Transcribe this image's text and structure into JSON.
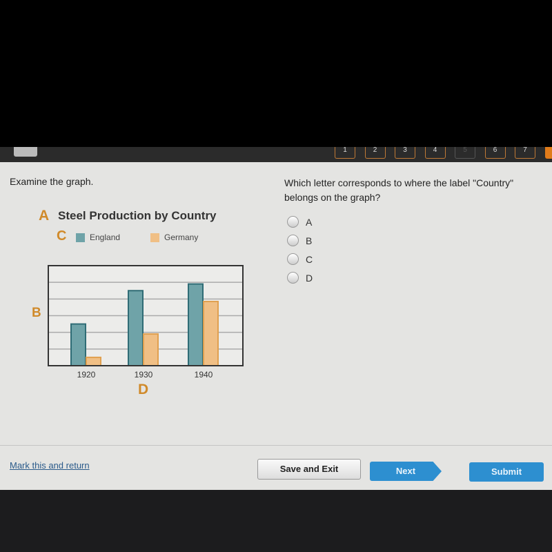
{
  "toolbar": {
    "pages": [
      {
        "label": "1",
        "state": "normal"
      },
      {
        "label": "2",
        "state": "normal"
      },
      {
        "label": "3",
        "state": "normal"
      },
      {
        "label": "4",
        "state": "normal"
      },
      {
        "label": "5",
        "state": "disabled"
      },
      {
        "label": "6",
        "state": "normal"
      },
      {
        "label": "7",
        "state": "normal"
      },
      {
        "label": "",
        "state": "current"
      }
    ]
  },
  "left": {
    "instruction": "Examine the graph."
  },
  "question": {
    "text": "Which letter corresponds to where the label \"Country\" belongs on the graph?",
    "options": [
      "A",
      "B",
      "C",
      "D"
    ]
  },
  "chart_data": {
    "type": "bar",
    "title": "Steel Production by Country",
    "categories": [
      "1920",
      "1930",
      "1940"
    ],
    "series": [
      {
        "name": "England",
        "color": "#6fa3a8",
        "values": [
          2.5,
          4.5,
          4.9
        ]
      },
      {
        "name": "Germany",
        "color": "#f0bf85",
        "values": [
          0.5,
          1.9,
          3.85
        ]
      }
    ],
    "ylim": [
      0,
      6
    ],
    "grid": true,
    "legend": "top",
    "annotations": {
      "title_marker": "A",
      "yaxis_marker": "B",
      "legend_marker": "C",
      "xaxis_marker": "D"
    }
  },
  "footer": {
    "mark_link": "Mark this and return",
    "save_exit": "Save and Exit",
    "next": "Next",
    "submit": "Submit"
  }
}
